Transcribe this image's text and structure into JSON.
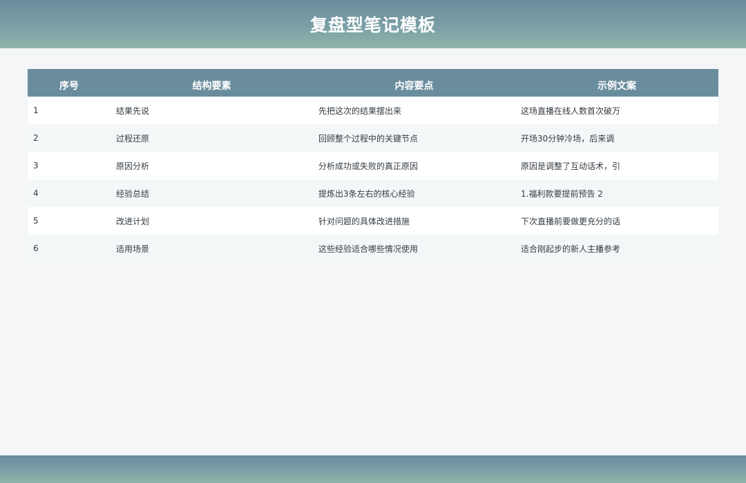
{
  "page": {
    "title": "复盘型笔记模板"
  },
  "table": {
    "headers": [
      "序号",
      "结构要素",
      "内容要点",
      "示例文案"
    ],
    "rows": [
      {
        "no": "1",
        "element": "结果先说",
        "point": "先把这次的结果摆出来",
        "example": "这场直播在线人数首次破万"
      },
      {
        "no": "2",
        "element": "过程还原",
        "point": "回顾整个过程中的关键节点",
        "example": "开场30分钟冷场，后来调"
      },
      {
        "no": "3",
        "element": "原因分析",
        "point": "分析成功或失败的真正原因",
        "example": "原因是调整了互动话术，引"
      },
      {
        "no": "4",
        "element": "经验总结",
        "point": "提炼出3条左右的核心经验",
        "example": "1.福利款要提前预告 2"
      },
      {
        "no": "5",
        "element": "改进计划",
        "point": "针对问题的具体改进措施",
        "example": "下次直播前要做更充分的话"
      },
      {
        "no": "6",
        "element": "适用场景",
        "point": "这些经验适合哪些情况使用",
        "example": "适合刚起步的新人主播参考"
      }
    ]
  },
  "colors": {
    "header_band": "#6a8d9d",
    "header_band_bottom": "#8fb5a9",
    "background": "#f4f6f8",
    "row_even": "#f4f7f8",
    "row_odd": "#ffffff",
    "text": "#333b42"
  }
}
